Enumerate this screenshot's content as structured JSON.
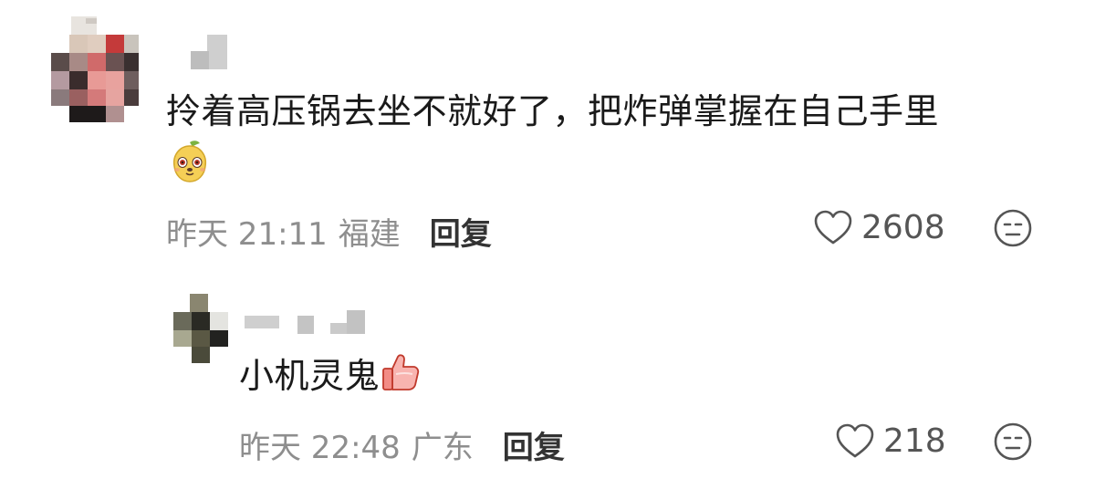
{
  "comments": [
    {
      "text": "拎着高压锅去坐不就好了，把炸弹掌握在自己手里",
      "sticker": "mango-face-sticker",
      "time": "昨天 21:11",
      "location": "福建",
      "reply_label": "回复",
      "likes": "2608",
      "like_icon": "heart-outline-icon",
      "dislike_icon": "unamused-face-icon"
    },
    {
      "text": "小机灵鬼",
      "inline_emoji": "thumbs-up-emoji",
      "time": "昨天 22:48",
      "location": "广东",
      "reply_label": "回复",
      "likes": "218",
      "like_icon": "heart-outline-icon",
      "dislike_icon": "unamused-face-icon"
    }
  ],
  "colors": {
    "text": "#1a1a1a",
    "meta": "#8e8e8e",
    "reply": "#333333",
    "icon": "#555555"
  }
}
